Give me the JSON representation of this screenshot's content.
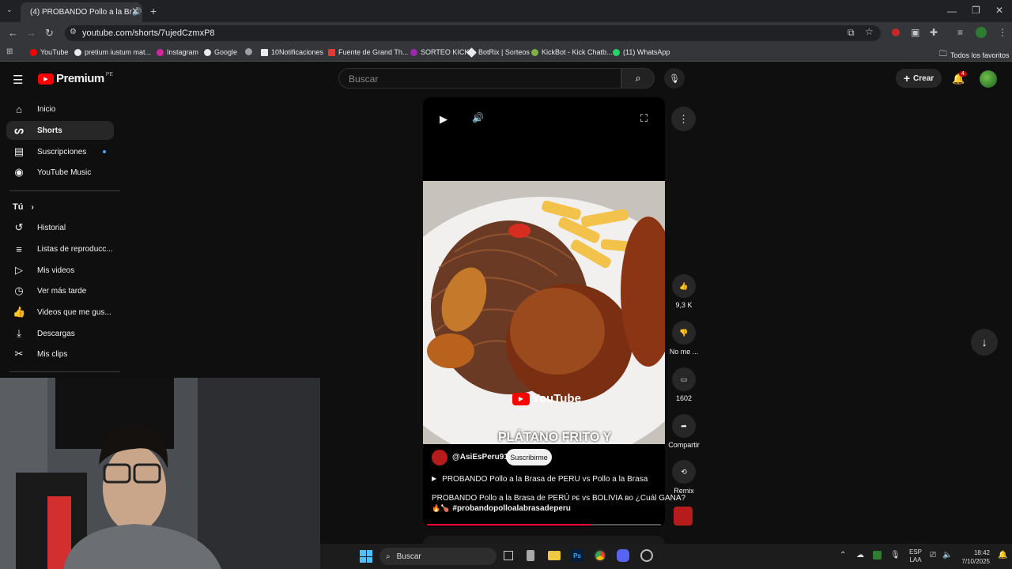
{
  "browser": {
    "tab_title": "(4) PROBANDO Pollo a la Br",
    "url": "youtube.com/shorts/7ujedCzmxP8",
    "bookmarks": [
      "YouTube",
      "pretium iustum mat...",
      "Instagram",
      "Google",
      "10Notificaciones",
      "Fuente de Grand Th...",
      "SORTEO KICK",
      "BotRix | Sorteos",
      "KickBot - Kick Chatb...",
      "(11) WhatsApp"
    ],
    "all_bookmarks": "Todos los favoritos"
  },
  "yt": {
    "logo": "Premium",
    "logo_country": "PE",
    "search_placeholder": "Buscar",
    "create": "Crear",
    "notif_count": "4",
    "sidebar": [
      "Inicio",
      "Shorts",
      "Suscripciones",
      "YouTube Music"
    ],
    "you_header": "Tú",
    "you_items": [
      "Historial",
      "Listas de reproducc...",
      "Mis videos",
      "Ver más tarde",
      "Videos que me gus...",
      "Descargas",
      "Mis clips"
    ]
  },
  "short": {
    "caption": "PLÁTANO FRITO Y",
    "channel": "@AsiEsPeru91",
    "subscribe": "Suscribirme",
    "playlist": "PROBANDO Pollo a la Brasa de PERU vs Pollo a la Brasa",
    "title_line1": "PROBANDO Pollo a la Brasa de PERÚ ᴘᴇ ᴠs BOLIVIA ʙᴏ ¿Cuál GANA?",
    "title_line2": "#probandopolloalabrasadeperu",
    "watermark": "YouTube",
    "progress": 0.7,
    "likes": "9,3 K",
    "dislike": "No me ...",
    "comments": "1602",
    "share": "Compartir",
    "remix": "Remix"
  },
  "taskbar": {
    "search": "Buscar",
    "lang1": "ESP",
    "lang2": "LAA",
    "time": "18:42",
    "date": "7/10/2025"
  }
}
